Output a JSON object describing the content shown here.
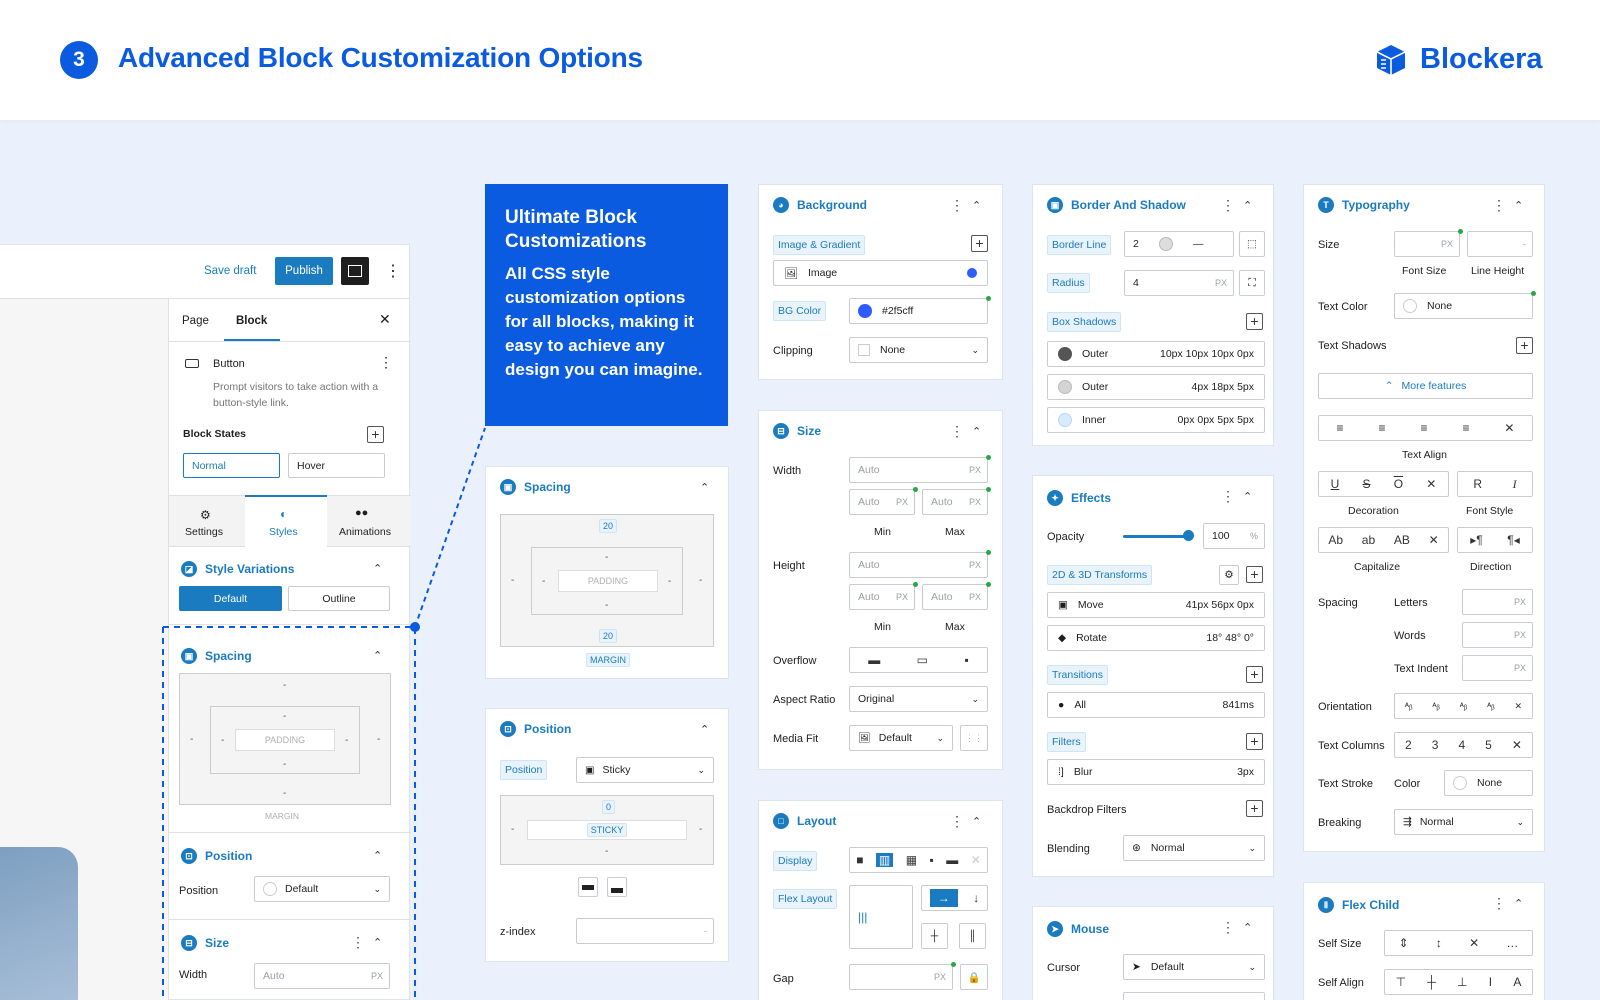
{
  "header": {
    "step": "3",
    "title": "Advanced Block Customization Options",
    "brand": "Blockera"
  },
  "promo": {
    "title": "Ultimate Block Customizations",
    "body": "All CSS style customization options for all blocks, making it easy to achieve any design you can imagine."
  },
  "editor": {
    "save_draft": "Save draft",
    "publish": "Publish",
    "tabs": [
      "Page",
      "Block"
    ],
    "block_name": "Button",
    "block_desc": "Prompt visitors to take action with a button-style link.",
    "block_states_label": "Block States",
    "states": [
      "Normal",
      "Hover"
    ],
    "inner_tabs": [
      "Settings",
      "Styles",
      "Animations"
    ],
    "style_variations": "Style Variations",
    "variations": [
      "Default",
      "Outline"
    ],
    "spacing": "Spacing",
    "padding": "PADDING",
    "margin": "MARGIN",
    "dash": "-",
    "position_title": "Position",
    "position_label": "Position",
    "position_value": "Default",
    "size_title": "Size",
    "width_label": "Width",
    "auto": "Auto",
    "px": "PX"
  },
  "spacing_panel": {
    "title": "Spacing",
    "margin_top": "20",
    "margin_bottom": "20",
    "padding": "PADDING",
    "margin": "MARGIN",
    "dash": "-"
  },
  "position_panel": {
    "title": "Position",
    "label": "Position",
    "value": "Sticky",
    "top": "0",
    "sticky": "STICKY",
    "dash": "-",
    "zindex": "z-index"
  },
  "background": {
    "title": "Background",
    "image_gradient": "Image & Gradient",
    "image": "Image",
    "bg_color_label": "BG Color",
    "bg_color": "#2f5cff",
    "clipping_label": "Clipping",
    "clipping": "None"
  },
  "size": {
    "title": "Size",
    "width": "Width",
    "height": "Height",
    "auto": "Auto",
    "px": "PX",
    "min": "Min",
    "max": "Max",
    "overflow": "Overflow",
    "aspect_label": "Aspect Ratio",
    "aspect": "Original",
    "media_label": "Media Fit",
    "media": "Default"
  },
  "layout": {
    "title": "Layout",
    "display": "Display",
    "flex_layout": "Flex Layout",
    "gap": "Gap",
    "px": "PX"
  },
  "border": {
    "title": "Border And Shadow",
    "border_line": "Border Line",
    "border_width": "2",
    "radius": "Radius",
    "radius_value": "4",
    "px": "PX",
    "box_shadows": "Box Shadows",
    "shadows": [
      {
        "type": "Outer",
        "value": "10px 10px 10px 0px",
        "color": "#555555"
      },
      {
        "type": "Outer",
        "value": "4px 18px 5px",
        "color": "#d4d4d4"
      },
      {
        "type": "Inner",
        "value": "0px 0px 5px 5px",
        "color": "#d6ecfb"
      }
    ]
  },
  "effects": {
    "title": "Effects",
    "opacity_label": "Opacity",
    "opacity": "100",
    "opacity_fraction": 1.0,
    "percent": "%",
    "transforms": "2D & 3D Transforms",
    "transform_items": [
      {
        "name": "Move",
        "value": "41px 56px 0px"
      },
      {
        "name": "Rotate",
        "value": "18° 48° 0°"
      }
    ],
    "transitions": "Transitions",
    "transition_item": {
      "name": "All",
      "value": "841ms"
    },
    "filters": "Filters",
    "filter_item": {
      "name": "Blur",
      "value": "3px"
    },
    "backdrop": "Backdrop Filters",
    "blending_label": "Blending",
    "blending": "Normal"
  },
  "mouse": {
    "title": "Mouse",
    "cursor_label": "Cursor",
    "cursor": "Default"
  },
  "typography": {
    "title": "Typography",
    "size": "Size",
    "px": "PX",
    "font_size": "Font Size",
    "line_height": "Line Height",
    "dash": "-",
    "text_color": "Text Color",
    "none": "None",
    "text_shadows": "Text Shadows",
    "more": "More features",
    "text_align": "Text Align",
    "decoration": "Decoration",
    "font_style": "Font Style",
    "capitalize": "Capitalize",
    "direction": "Direction",
    "spacing": "Spacing",
    "letters": "Letters",
    "words": "Words",
    "indent": "Text Indent",
    "orientation": "Orientation",
    "columns_label": "Text Columns",
    "columns": [
      "2",
      "3",
      "4",
      "5"
    ],
    "stroke": "Text Stroke",
    "color": "Color",
    "breaking_label": "Breaking",
    "breaking": "Normal",
    "cap": [
      "Ab",
      "ab",
      "AB"
    ],
    "fs": [
      "R",
      "I"
    ]
  },
  "flex_child": {
    "title": "Flex Child",
    "self_size": "Self Size",
    "self_align": "Self Align"
  }
}
